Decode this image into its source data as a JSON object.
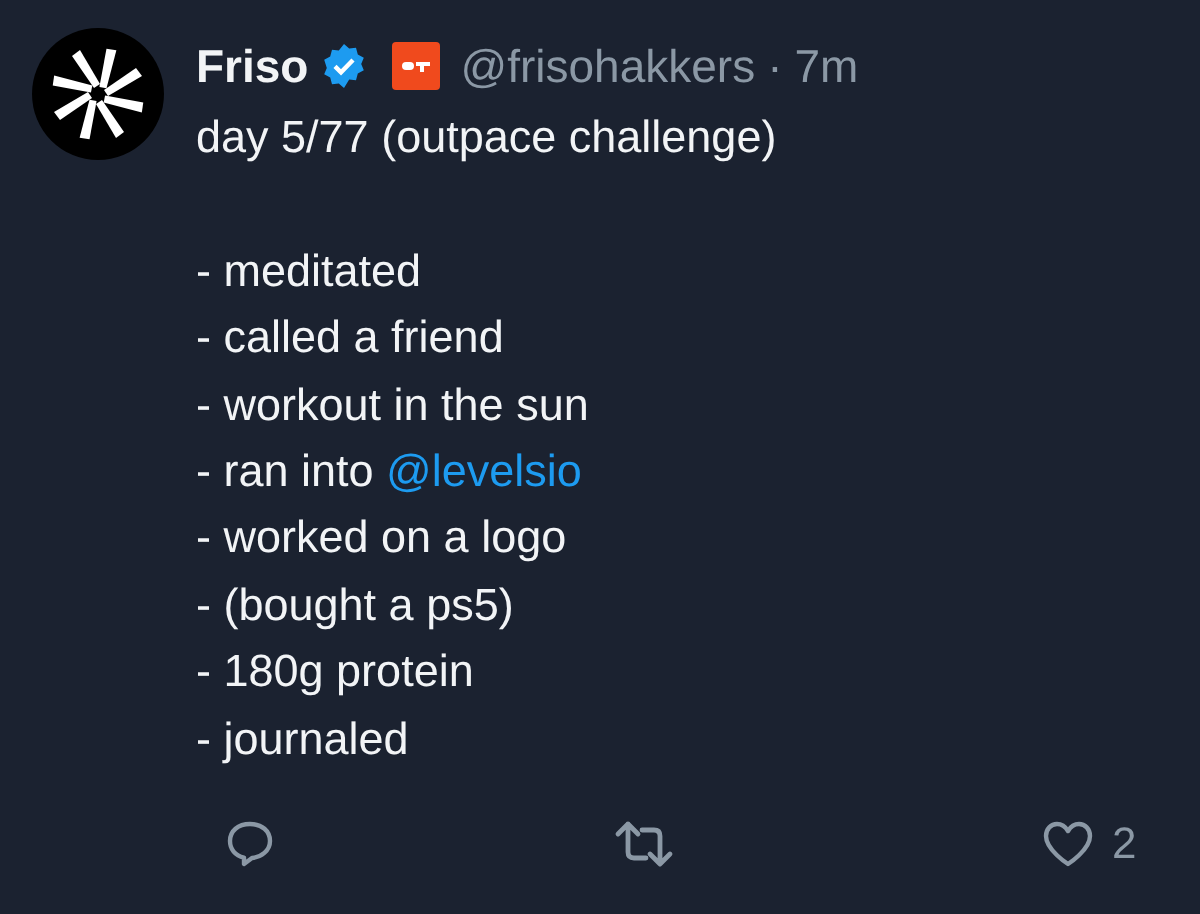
{
  "author": {
    "name": "Friso",
    "verified": true,
    "handle": "@frisohakkers",
    "separator": "·",
    "time": "7m"
  },
  "intro": "day 5/77 (outpace challenge)",
  "items": [
    {
      "text": "- meditated"
    },
    {
      "text": "- called a friend"
    },
    {
      "text": "- workout in the sun"
    },
    {
      "text": "- ran into ",
      "mention": "@levelsio"
    },
    {
      "text": "- worked on a logo"
    },
    {
      "text": "- (bought a ps5)"
    },
    {
      "text": "- 180g protein"
    },
    {
      "text": "- journaled"
    }
  ],
  "actions": {
    "likes": "2"
  }
}
